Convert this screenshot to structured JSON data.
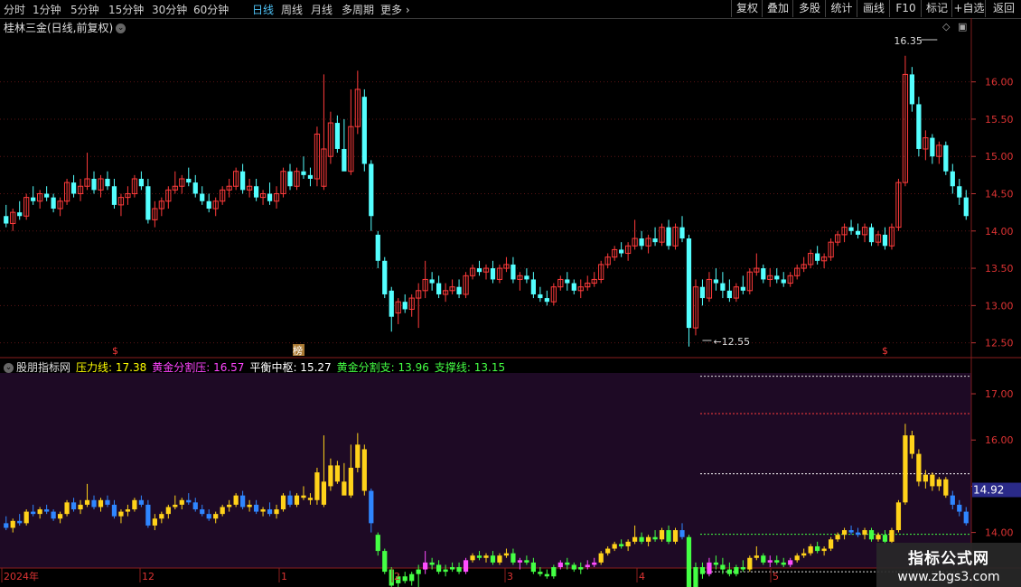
{
  "toolbar": {
    "timeframes": [
      "分时",
      "1分钟",
      "5分钟",
      "15分钟",
      "30分钟",
      "60分钟",
      "日线",
      "周线",
      "月线",
      "多周期",
      "更多"
    ],
    "active_timeframe": "日线",
    "buttons": [
      "复权",
      "叠加",
      "多股",
      "统计",
      "画线",
      "F10",
      "标记",
      "+自选",
      "返回"
    ]
  },
  "main_chart": {
    "title": "桂林三金(日线,前复权)",
    "price_ticks": [
      "16.00",
      "15.50",
      "15.00",
      "14.50",
      "14.00",
      "13.50",
      "13.00",
      "12.50"
    ],
    "high_label": "16.35",
    "low_label": "12.55",
    "markers": [
      "$",
      "榜",
      "$"
    ],
    "up_color": "#ff3b3b",
    "down_color": "#54ffff"
  },
  "indicator": {
    "name": "股朋指标网",
    "lines": [
      {
        "label": "压力线:",
        "value": "17.38",
        "color": "#ffff00"
      },
      {
        "label": "黄金分割压:",
        "value": "16.57",
        "color": "#ff44ff"
      },
      {
        "label": "平衡中枢:",
        "value": "15.27",
        "color": "#ffffff"
      },
      {
        "label": "黄金分割支:",
        "value": "13.96",
        "color": "#44ff44"
      },
      {
        "label": "支撑线:",
        "value": "13.15",
        "color": "#44ff44"
      }
    ],
    "ticks": [
      "17.00",
      "16.00",
      "15.00",
      "14.00"
    ],
    "current_price": "14.92"
  },
  "date_axis": [
    "2024年",
    "12",
    "1",
    "2",
    "3",
    "4",
    "5"
  ],
  "chart_data": {
    "type": "candlestick",
    "title": "桂林三金(日线,前复权)",
    "ylim": [
      12.35,
      16.65
    ],
    "x_labels": [
      "2024年",
      "12",
      "1",
      "2",
      "3",
      "4",
      "5"
    ],
    "series_ohlc": [
      [
        14.2,
        14.35,
        14.05,
        14.1
      ],
      [
        14.1,
        14.3,
        14.0,
        14.25
      ],
      [
        14.25,
        14.4,
        14.15,
        14.2
      ],
      [
        14.2,
        14.5,
        14.15,
        14.45
      ],
      [
        14.45,
        14.6,
        14.35,
        14.4
      ],
      [
        14.4,
        14.55,
        14.3,
        14.5
      ],
      [
        14.5,
        14.6,
        14.4,
        14.45
      ],
      [
        14.45,
        14.5,
        14.25,
        14.3
      ],
      [
        14.3,
        14.45,
        14.2,
        14.4
      ],
      [
        14.4,
        14.7,
        14.35,
        14.65
      ],
      [
        14.65,
        14.75,
        14.45,
        14.5
      ],
      [
        14.5,
        14.7,
        14.4,
        14.6
      ],
      [
        14.6,
        15.05,
        14.55,
        14.7
      ],
      [
        14.7,
        14.8,
        14.5,
        14.55
      ],
      [
        14.55,
        14.75,
        14.45,
        14.7
      ],
      [
        14.7,
        14.8,
        14.55,
        14.6
      ],
      [
        14.6,
        14.7,
        14.3,
        14.35
      ],
      [
        14.35,
        14.5,
        14.2,
        14.45
      ],
      [
        14.45,
        14.6,
        14.35,
        14.5
      ],
      [
        14.5,
        14.75,
        14.45,
        14.7
      ],
      [
        14.7,
        14.8,
        14.55,
        14.6
      ],
      [
        14.6,
        14.7,
        14.1,
        14.15
      ],
      [
        14.15,
        14.4,
        14.05,
        14.3
      ],
      [
        14.3,
        14.45,
        14.2,
        14.4
      ],
      [
        14.4,
        14.6,
        14.3,
        14.55
      ],
      [
        14.55,
        14.8,
        14.5,
        14.6
      ],
      [
        14.6,
        14.75,
        14.5,
        14.7
      ],
      [
        14.7,
        14.85,
        14.6,
        14.65
      ],
      [
        14.65,
        14.75,
        14.45,
        14.5
      ],
      [
        14.5,
        14.6,
        14.35,
        14.4
      ],
      [
        14.4,
        14.5,
        14.25,
        14.3
      ],
      [
        14.3,
        14.45,
        14.2,
        14.4
      ],
      [
        14.4,
        14.6,
        14.35,
        14.55
      ],
      [
        14.55,
        14.7,
        14.45,
        14.6
      ],
      [
        14.6,
        14.85,
        14.55,
        14.8
      ],
      [
        14.8,
        14.9,
        14.5,
        14.55
      ],
      [
        14.55,
        14.7,
        14.45,
        14.6
      ],
      [
        14.6,
        14.7,
        14.4,
        14.45
      ],
      [
        14.45,
        14.55,
        14.35,
        14.5
      ],
      [
        14.5,
        14.65,
        14.35,
        14.4
      ],
      [
        14.4,
        14.6,
        14.3,
        14.5
      ],
      [
        14.5,
        14.85,
        14.45,
        14.8
      ],
      [
        14.8,
        14.9,
        14.55,
        14.6
      ],
      [
        14.6,
        14.85,
        14.55,
        14.8
      ],
      [
        14.8,
        15.0,
        14.7,
        14.75
      ],
      [
        14.75,
        14.85,
        14.6,
        14.7
      ],
      [
        14.7,
        15.4,
        14.6,
        15.3
      ],
      [
        14.6,
        16.1,
        14.55,
        15.1
      ],
      [
        15.0,
        15.6,
        14.9,
        15.45
      ],
      [
        15.45,
        15.55,
        15.05,
        15.1
      ],
      [
        15.1,
        15.5,
        14.85,
        14.8
      ],
      [
        14.8,
        15.9,
        14.75,
        15.4
      ],
      [
        15.4,
        16.15,
        15.3,
        15.9
      ],
      [
        15.8,
        15.9,
        14.8,
        14.9
      ],
      [
        14.9,
        14.95,
        14.0,
        14.2
      ],
      [
        13.95,
        14.0,
        13.5,
        13.6
      ],
      [
        13.6,
        13.65,
        13.1,
        13.15
      ],
      [
        13.2,
        13.25,
        12.65,
        12.85
      ],
      [
        12.9,
        13.1,
        12.75,
        13.05
      ],
      [
        13.05,
        13.15,
        12.9,
        12.95
      ],
      [
        12.95,
        13.15,
        12.85,
        13.1
      ],
      [
        13.1,
        13.3,
        12.7,
        13.2
      ],
      [
        13.2,
        13.6,
        13.1,
        13.35
      ],
      [
        13.35,
        13.45,
        13.2,
        13.3
      ],
      [
        13.3,
        13.4,
        13.1,
        13.15
      ],
      [
        13.15,
        13.3,
        13.05,
        13.2
      ],
      [
        13.2,
        13.35,
        13.15,
        13.25
      ],
      [
        13.25,
        13.35,
        13.1,
        13.15
      ],
      [
        13.15,
        13.45,
        13.1,
        13.4
      ],
      [
        13.4,
        13.55,
        13.35,
        13.5
      ],
      [
        13.5,
        13.6,
        13.4,
        13.45
      ],
      [
        13.45,
        13.55,
        13.35,
        13.5
      ],
      [
        13.5,
        13.6,
        13.3,
        13.35
      ],
      [
        13.35,
        13.55,
        13.3,
        13.5
      ],
      [
        13.5,
        13.65,
        13.45,
        13.55
      ],
      [
        13.55,
        13.65,
        13.3,
        13.35
      ],
      [
        13.35,
        13.45,
        13.2,
        13.4
      ],
      [
        13.4,
        13.5,
        13.3,
        13.35
      ],
      [
        13.35,
        13.45,
        13.1,
        13.15
      ],
      [
        13.15,
        13.25,
        13.05,
        13.1
      ],
      [
        13.1,
        13.2,
        13.0,
        13.05
      ],
      [
        13.05,
        13.3,
        13.0,
        13.25
      ],
      [
        13.25,
        13.4,
        13.2,
        13.35
      ],
      [
        13.35,
        13.45,
        13.2,
        13.3
      ],
      [
        13.3,
        13.35,
        13.15,
        13.2
      ],
      [
        13.2,
        13.35,
        13.1,
        13.25
      ],
      [
        13.25,
        13.4,
        13.2,
        13.3
      ],
      [
        13.3,
        13.45,
        13.25,
        13.35
      ],
      [
        13.35,
        13.6,
        13.3,
        13.55
      ],
      [
        13.55,
        13.7,
        13.5,
        13.65
      ],
      [
        13.65,
        13.8,
        13.6,
        13.75
      ],
      [
        13.75,
        13.85,
        13.65,
        13.7
      ],
      [
        13.7,
        13.85,
        13.6,
        13.8
      ],
      [
        13.8,
        14.15,
        13.75,
        13.9
      ],
      [
        13.9,
        14.0,
        13.75,
        13.8
      ],
      [
        13.8,
        13.95,
        13.7,
        13.9
      ],
      [
        13.9,
        14.05,
        13.8,
        13.85
      ],
      [
        13.85,
        14.1,
        13.8,
        14.05
      ],
      [
        14.05,
        14.15,
        13.75,
        13.8
      ],
      [
        13.8,
        14.1,
        13.75,
        14.05
      ],
      [
        14.05,
        14.2,
        13.85,
        13.9
      ],
      [
        13.9,
        13.95,
        12.45,
        12.7
      ],
      [
        12.7,
        13.35,
        12.6,
        13.25
      ],
      [
        13.25,
        13.35,
        13.0,
        13.1
      ],
      [
        13.1,
        13.45,
        13.05,
        13.35
      ],
      [
        13.35,
        13.5,
        13.2,
        13.3
      ],
      [
        13.3,
        13.45,
        13.1,
        13.2
      ],
      [
        13.2,
        13.35,
        13.05,
        13.1
      ],
      [
        13.1,
        13.3,
        13.05,
        13.25
      ],
      [
        13.25,
        13.4,
        13.15,
        13.2
      ],
      [
        13.2,
        13.5,
        13.15,
        13.45
      ],
      [
        13.45,
        13.7,
        13.4,
        13.5
      ],
      [
        13.5,
        13.55,
        13.3,
        13.35
      ],
      [
        13.35,
        13.5,
        13.25,
        13.4
      ],
      [
        13.4,
        13.5,
        13.3,
        13.35
      ],
      [
        13.35,
        13.45,
        13.25,
        13.3
      ],
      [
        13.3,
        13.45,
        13.25,
        13.4
      ],
      [
        13.4,
        13.55,
        13.35,
        13.5
      ],
      [
        13.5,
        13.65,
        13.45,
        13.55
      ],
      [
        13.55,
        13.75,
        13.5,
        13.7
      ],
      [
        13.7,
        13.8,
        13.55,
        13.6
      ],
      [
        13.6,
        13.7,
        13.5,
        13.65
      ],
      [
        13.65,
        13.9,
        13.6,
        13.85
      ],
      [
        13.85,
        14.0,
        13.8,
        13.95
      ],
      [
        13.95,
        14.1,
        13.85,
        14.05
      ],
      [
        14.05,
        14.15,
        13.95,
        14.0
      ],
      [
        14.0,
        14.1,
        13.9,
        13.95
      ],
      [
        13.95,
        14.1,
        13.85,
        14.05
      ],
      [
        14.05,
        14.1,
        13.8,
        13.85
      ],
      [
        13.85,
        14.0,
        13.8,
        13.95
      ],
      [
        13.95,
        14.05,
        13.75,
        13.8
      ],
      [
        13.8,
        14.1,
        13.75,
        14.05
      ],
      [
        14.05,
        14.7,
        14.0,
        14.65
      ],
      [
        14.65,
        16.35,
        14.6,
        16.1
      ],
      [
        16.1,
        16.2,
        15.6,
        15.7
      ],
      [
        15.7,
        15.8,
        15.0,
        15.1
      ],
      [
        15.1,
        15.35,
        14.95,
        15.25
      ],
      [
        15.25,
        15.3,
        14.9,
        15.0
      ],
      [
        15.0,
        15.2,
        14.9,
        15.15
      ],
      [
        15.15,
        15.2,
        14.75,
        14.8
      ],
      [
        14.8,
        14.9,
        14.5,
        14.6
      ],
      [
        14.6,
        14.7,
        14.35,
        14.45
      ],
      [
        14.45,
        14.55,
        14.15,
        14.2
      ]
    ]
  }
}
